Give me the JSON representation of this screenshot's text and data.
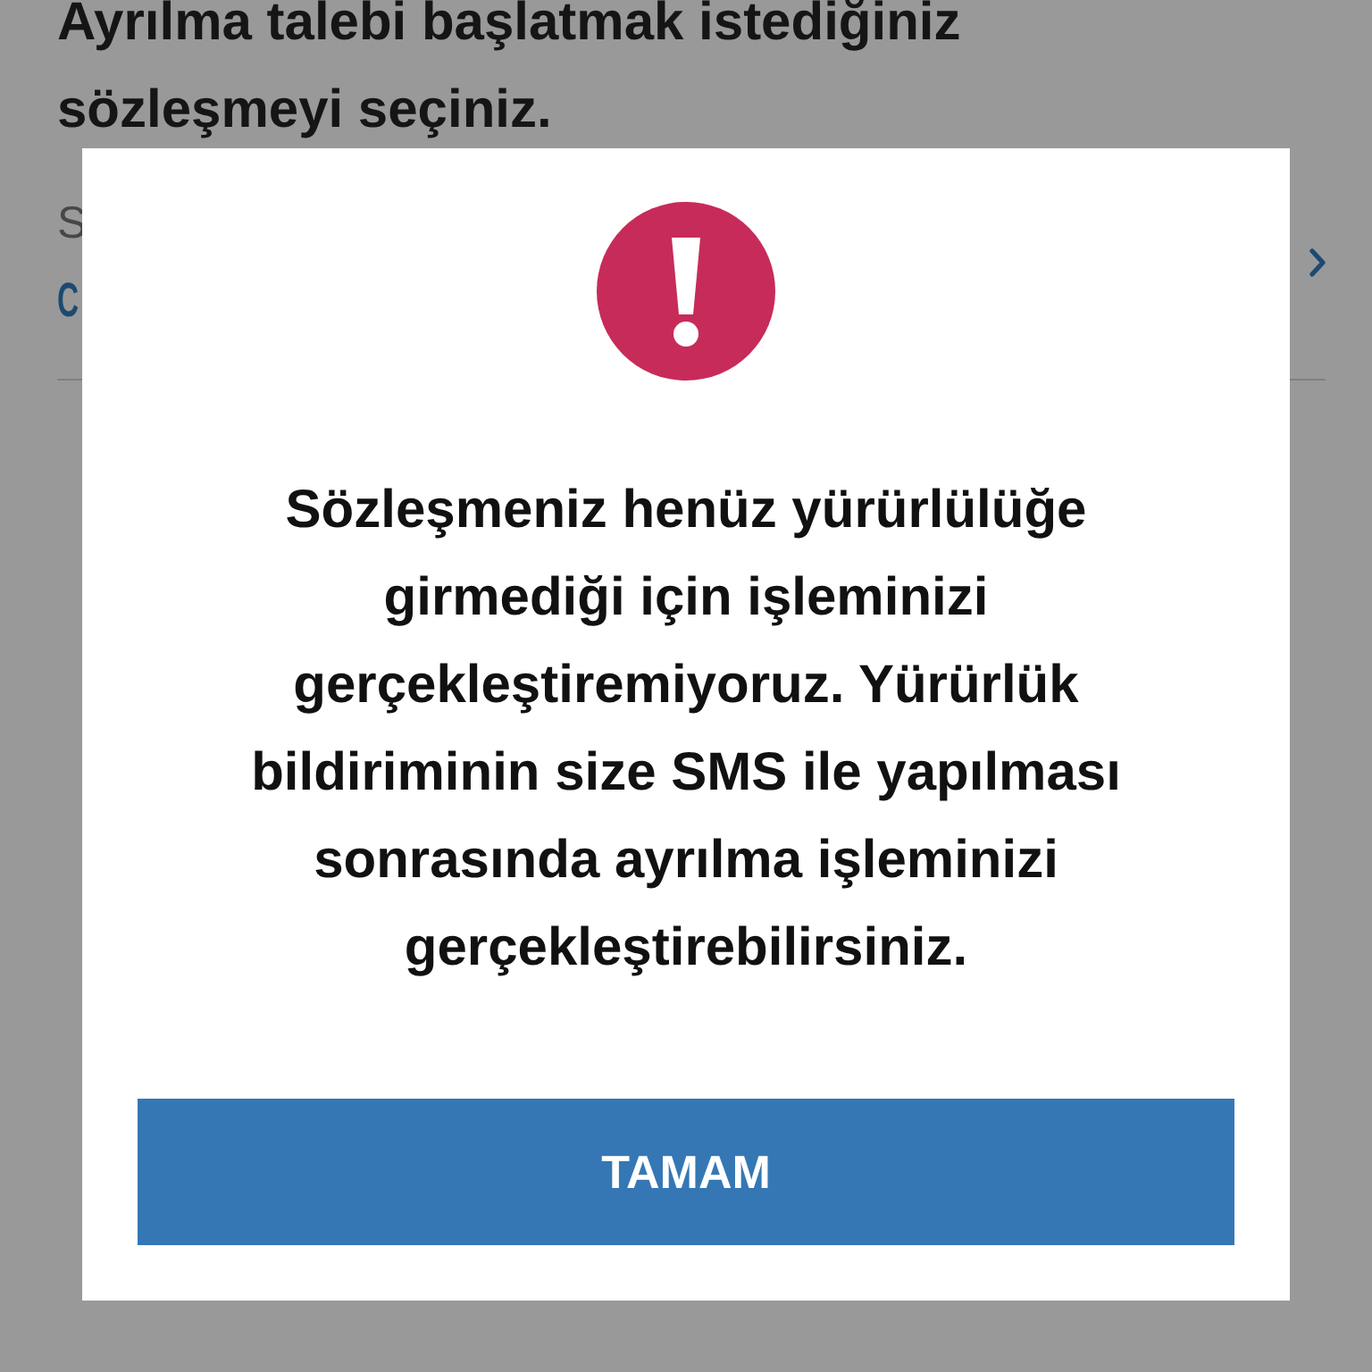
{
  "page": {
    "heading": "Ayrılma talebi başlatmak istediğiniz sözleşmeyi seçiniz.",
    "contract_row": {
      "label": "S",
      "value": "C"
    }
  },
  "dialog": {
    "message": "Sözleşmeniz henüz yürürlülüğe girmediği için işleminizi gerçekleştiremiyoruz. Yürürlük bildiriminin size SMS ile yapılması sonrasında ayrılma işleminizi gerçekleştirebilirsiniz.",
    "button": "TAMAM"
  }
}
